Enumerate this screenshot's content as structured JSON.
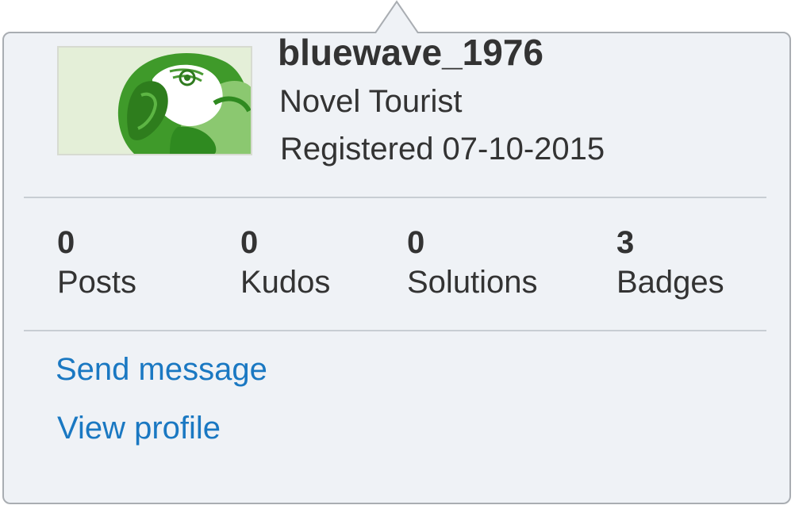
{
  "profile": {
    "username": "bluewave_1976",
    "rank": "Novel Tourist",
    "registered": "Registered 07-10-2015",
    "avatar_icon": "parrot-avatar-icon"
  },
  "stats": [
    {
      "value": "0",
      "label": "Posts"
    },
    {
      "value": "0",
      "label": "Kudos"
    },
    {
      "value": "0",
      "label": "Solutions"
    },
    {
      "value": "3",
      "label": "Badges"
    }
  ],
  "actions": {
    "send_message": "Send message",
    "view_profile": "View profile"
  },
  "colors": {
    "card_background": "#eff2f6",
    "card_border": "#a9adb2",
    "link": "#1a78c2",
    "text": "#333333",
    "divider": "#c8cdd3"
  }
}
